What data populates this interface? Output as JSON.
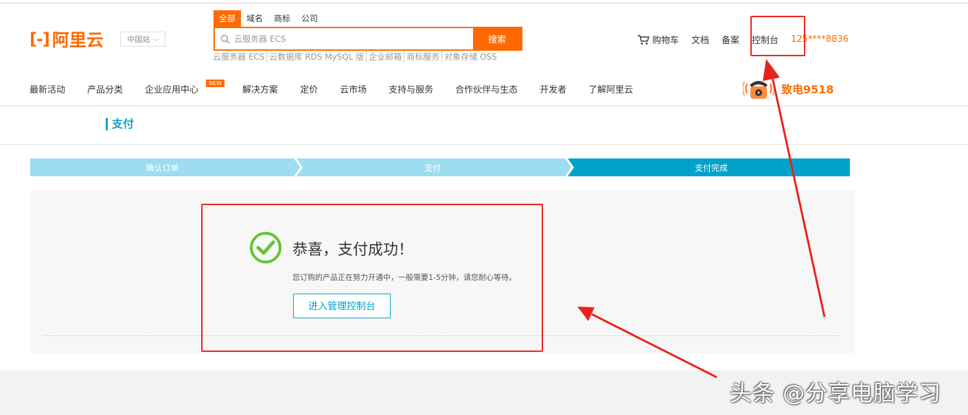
{
  "header": {
    "logo_mark": "[-]",
    "logo_text": "阿里云",
    "region": "中国站",
    "search_tabs": [
      "全部",
      "域名",
      "商标",
      "公司"
    ],
    "search_placeholder": "云服务器 ECS",
    "search_button": "搜索",
    "hotwords": [
      "云服务器 ECS",
      "云数据库 RDS MySQL 版",
      "企业邮箱",
      "商标服务",
      "对象存储 OSS"
    ],
    "cart": "购物车",
    "docs": "文档",
    "record": "备案",
    "console": "控制台",
    "phone_masked": "125****8836"
  },
  "nav": {
    "items": [
      "最新活动",
      "产品分类",
      "企业应用中心",
      "解决方案",
      "定价",
      "云市场",
      "支持与服务",
      "合作伙伴与生态",
      "开发者",
      "了解阿里云"
    ],
    "badge": "NEW",
    "hotline": "致电9518"
  },
  "section_title": "支付",
  "steps": [
    "确认订单",
    "支付",
    "支付完成"
  ],
  "success": {
    "title": "恭喜，支付成功！",
    "desc": "您订购的产品正在努力开通中，一般需要1-5分钟，请您耐心等待。",
    "button": "进入管理控制台"
  },
  "watermark": "头条 @分享电脑学习",
  "colors": {
    "brand_orange": "#ff6a00",
    "step_light": "#9edcf2",
    "step_dark": "#00a2ca",
    "success_green": "#67c23a",
    "annotation_red": "#e8231f"
  }
}
